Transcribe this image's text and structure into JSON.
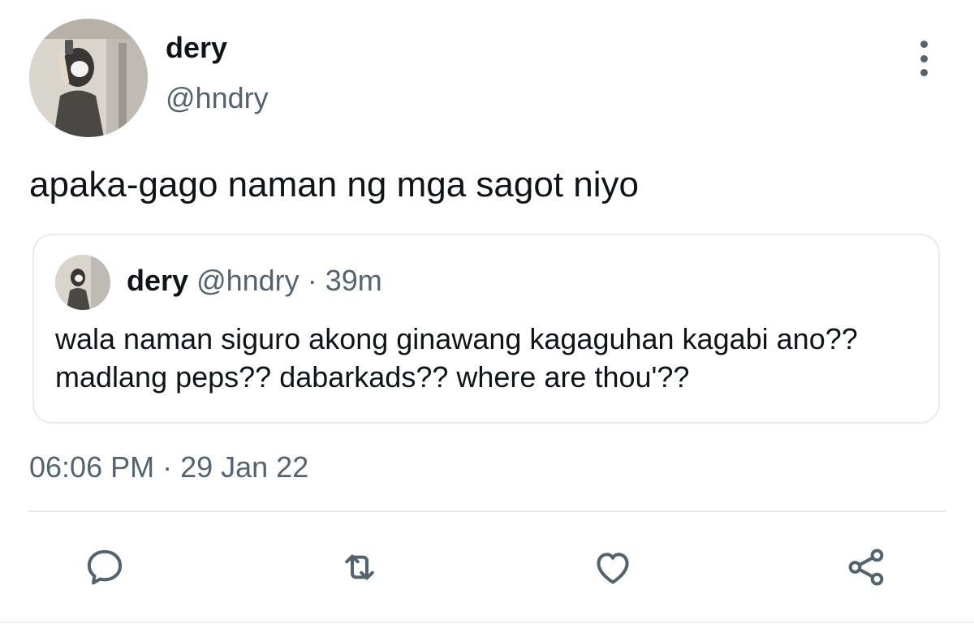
{
  "tweet": {
    "author": {
      "display_name": "dery",
      "handle": "@hndry"
    },
    "text": "apaka-gago naman ng mga sagot niyo",
    "quoted": {
      "display_name": "dery",
      "handle": "@hndry",
      "separator": "·",
      "time_ago": "39m",
      "text": "wala naman siguro akong ginawang kagaguhan kagabi ano?? madlang peps?? dabarkads?? where are thou'??"
    },
    "timestamp": "06:06 PM · 29 Jan 22"
  },
  "actions": [
    {
      "name": "reply",
      "icon": "reply-icon"
    },
    {
      "name": "retweet",
      "icon": "retweet-icon"
    },
    {
      "name": "like",
      "icon": "heart-icon"
    },
    {
      "name": "share",
      "icon": "share-icon"
    }
  ],
  "colors": {
    "primary_text": "#0f1419",
    "secondary_text": "#536471",
    "border": "#e7eaee"
  }
}
